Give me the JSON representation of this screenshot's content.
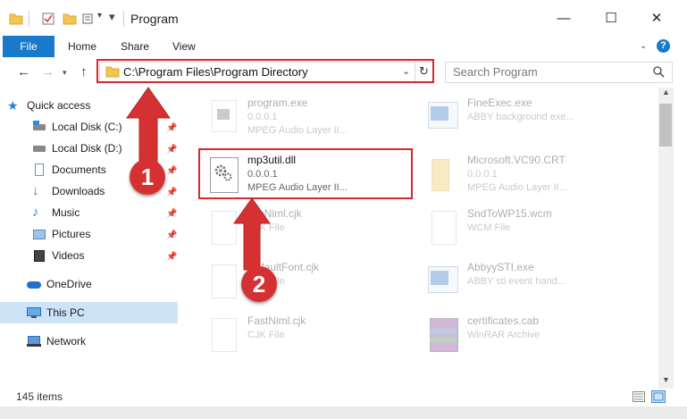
{
  "window": {
    "title": "Program",
    "minimize": "—",
    "maximize": "☐",
    "close": "✕"
  },
  "ribbon": {
    "tabs": [
      "File",
      "Home",
      "Share",
      "View"
    ],
    "help": "?"
  },
  "address": {
    "path": "C:\\Program Files\\Program Directory",
    "search_placeholder": "Search Program"
  },
  "nav": {
    "items": [
      {
        "label": "Quick access"
      },
      {
        "label": "Local Disk (C:)"
      },
      {
        "label": "Local Disk (D:)"
      },
      {
        "label": "Documents"
      },
      {
        "label": "Downloads"
      },
      {
        "label": "Music"
      },
      {
        "label": "Pictures"
      },
      {
        "label": "Videos"
      },
      {
        "label": "OneDrive"
      },
      {
        "label": "This PC"
      },
      {
        "label": "Network"
      }
    ]
  },
  "files": [
    {
      "name": "program.exe",
      "line2": "0.0.0.1",
      "line3": "MPEG Audio Layer II..."
    },
    {
      "name": "FineExec.exe",
      "line2": "ABBY background exe...",
      "line3": ""
    },
    {
      "name": "mp3util.dll",
      "line2": "0.0.0.1",
      "line3": "MPEG Audio Layer II..."
    },
    {
      "name": "Microsoft.VC90.CRT",
      "line2": "0.0.0.1",
      "line3": "MPEG Audio Layer II..."
    },
    {
      "name": "ProNiml.cjk",
      "line2": "CJK File",
      "line3": ""
    },
    {
      "name": "SndToWP15.wcm",
      "line2": "WCM File",
      "line3": ""
    },
    {
      "name": "DefaultFont.cjk",
      "line2": "CJK File",
      "line3": ""
    },
    {
      "name": "AbbyySTI.exe",
      "line2": "ABBY sti event hand...",
      "line3": ""
    },
    {
      "name": "FastNiml.cjk",
      "line2": "CJK File",
      "line3": ""
    },
    {
      "name": "certificates.cab",
      "line2": "WinRAR Archive",
      "line3": ""
    }
  ],
  "status": {
    "count": "145 items"
  },
  "callouts": [
    "1",
    "2"
  ],
  "colors": {
    "accent": "#1979ca",
    "highlight": "#d9262f",
    "callout": "#d63132"
  }
}
